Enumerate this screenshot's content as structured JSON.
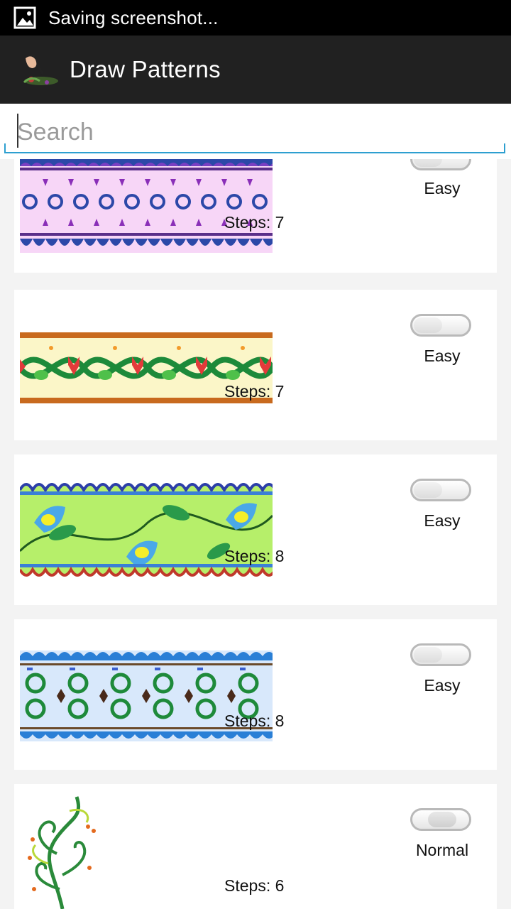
{
  "status_bar": {
    "icon": "image-icon",
    "text": "Saving screenshot..."
  },
  "action_bar": {
    "title": "Draw Patterns",
    "logo": "paintbrush-logo"
  },
  "search": {
    "placeholder": "Search",
    "value": ""
  },
  "patterns": [
    {
      "steps_label": "Steps: 7",
      "difficulty": "Easy",
      "pattern": "purple-scroll-border"
    },
    {
      "steps_label": "Steps: 7",
      "difficulty": "Easy",
      "pattern": "red-green-heart-vine-border"
    },
    {
      "steps_label": "Steps: 8",
      "difficulty": "Easy",
      "pattern": "blue-flower-green-vine-border"
    },
    {
      "steps_label": "Steps: 8",
      "difficulty": "Easy",
      "pattern": "blue-green-tile-border"
    },
    {
      "steps_label": "Steps: 6",
      "difficulty": "Normal",
      "pattern": "green-swirl-vine"
    }
  ],
  "colors": {
    "accent": "#2d9fd0",
    "action_bar": "#212121",
    "status_bar": "#000000"
  }
}
